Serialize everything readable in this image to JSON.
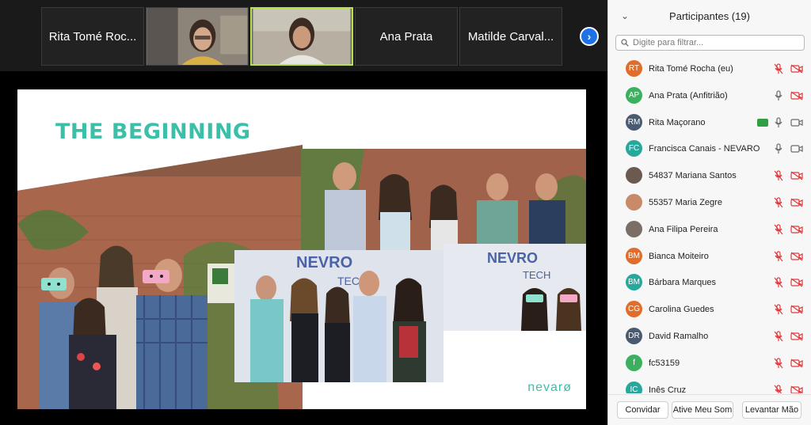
{
  "strip": {
    "tiles": [
      {
        "name": "Rita Tomé Rocha (eu)",
        "display": "Rita Tomé Roc..."
      },
      {
        "name": "",
        "type": "video"
      },
      {
        "name": "",
        "type": "video",
        "active": true
      },
      {
        "name": "Ana Prata",
        "display": "Ana Prata"
      },
      {
        "name": "Matilde Carvalho",
        "display": "Matilde Carval..."
      }
    ],
    "next_icon": "chevron-right-icon"
  },
  "slide": {
    "title": "THE BEGINNING",
    "logo_text": "nevarø",
    "accent": "#3cbfa8"
  },
  "panel": {
    "title": "Participantes (19)",
    "filter_placeholder": "Digite para filtrar...",
    "participants": [
      {
        "initials": "RT",
        "name": "Rita Tomé Rocha (eu)",
        "color": "#e06d2b",
        "mic": "muted",
        "cam": "off"
      },
      {
        "initials": "AP",
        "name": "Ana Prata (Anfitrião)",
        "color": "#3db060",
        "mic": "on",
        "cam": "off"
      },
      {
        "initials": "RM",
        "name": "Rita Maçorano",
        "color": "#4a5a70",
        "mic": "on",
        "cam": "on",
        "sharing": true
      },
      {
        "initials": "FC",
        "name": "Francisca Canais - NEVARO",
        "color": "#28a89c",
        "mic": "on",
        "cam": "on"
      },
      {
        "initials": "",
        "name": "54837 Mariana Santos",
        "color": "#6a5a4f",
        "mic": "muted",
        "cam": "off",
        "photo": true
      },
      {
        "initials": "",
        "name": "55357 Maria Zegre",
        "color": "#c98a6a",
        "mic": "muted",
        "cam": "off",
        "photo": true
      },
      {
        "initials": "",
        "name": "Ana Filipa Pereira",
        "color": "#7a6e66",
        "mic": "muted",
        "cam": "off",
        "photo": true
      },
      {
        "initials": "BM",
        "name": "Bianca Moiteiro",
        "color": "#e06d2b",
        "mic": "muted",
        "cam": "off"
      },
      {
        "initials": "BM",
        "name": "Bárbara Marques",
        "color": "#28a89c",
        "mic": "muted",
        "cam": "off"
      },
      {
        "initials": "CG",
        "name": "Carolina Guedes",
        "color": "#e06d2b",
        "mic": "muted",
        "cam": "off"
      },
      {
        "initials": "DR",
        "name": "David Ramalho",
        "color": "#4a5a70",
        "mic": "muted",
        "cam": "off"
      },
      {
        "initials": "f",
        "name": "fc53159",
        "color": "#3db060",
        "mic": "muted",
        "cam": "off"
      },
      {
        "initials": "IC",
        "name": "Inês Cruz",
        "color": "#28a89c",
        "mic": "muted",
        "cam": "off"
      }
    ],
    "footer": {
      "invite": "Convidar",
      "unmute": "Ative Meu Som",
      "raise_hand": "Levantar Mão"
    }
  },
  "colors": {
    "muted_red": "#e0383b",
    "icon_gray": "#6b6b6b",
    "accent_blue": "#1e72e8"
  }
}
